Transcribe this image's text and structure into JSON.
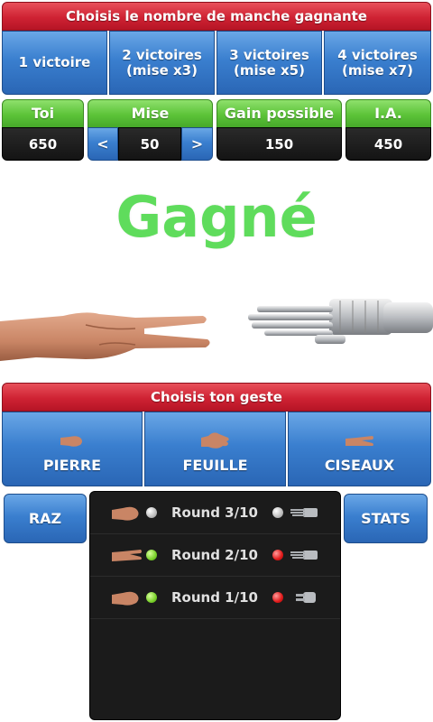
{
  "round_selector": {
    "title": "Choisis le nombre de manche gagnante",
    "options": [
      {
        "line1": "1 victoire",
        "line2": ""
      },
      {
        "line1": "2 victoires",
        "line2": "(mise x3)"
      },
      {
        "line1": "3 victoires",
        "line2": "(mise x5)"
      },
      {
        "line1": "4 victoires",
        "line2": "(mise x7)"
      }
    ]
  },
  "stats_bar": {
    "player_label": "Toi",
    "player_value": "650",
    "bet_label": "Mise",
    "bet_value": "50",
    "bet_decrease": "<",
    "bet_increase": ">",
    "gain_label": "Gain possible",
    "gain_value": "150",
    "ai_label": "I.A.",
    "ai_value": "450"
  },
  "result": {
    "text": "Gagné",
    "color": "#5fdc5c"
  },
  "gesture_selector": {
    "title": "Choisis ton geste",
    "options": [
      {
        "label": "PIERRE",
        "icon": "rock-hand-icon"
      },
      {
        "label": "FEUILLE",
        "icon": "paper-hand-icon"
      },
      {
        "label": "CISEAUX",
        "icon": "scissors-hand-icon"
      }
    ]
  },
  "controls": {
    "reset_label": "RAZ",
    "stats_label": "STATS"
  },
  "history": [
    {
      "label": "Round 3/10",
      "player_dot": "gray",
      "ai_dot": "gray",
      "player_icon": "rock-hand-icon",
      "ai_icon": "robot-paper-hand-icon"
    },
    {
      "label": "Round 2/10",
      "player_dot": "green",
      "ai_dot": "red",
      "player_icon": "scissors-hand-icon",
      "ai_icon": "robot-paper-hand-icon"
    },
    {
      "label": "Round 1/10",
      "player_dot": "green",
      "ai_dot": "red",
      "player_icon": "rock-hand-icon",
      "ai_icon": "robot-scissors-hand-icon"
    }
  ],
  "colors": {
    "accent_red": "#cf2233",
    "accent_blue": "#3a7fcf",
    "accent_green": "#5cc338",
    "win_dot": "#7ad12a",
    "lose_dot": "#e01919"
  }
}
